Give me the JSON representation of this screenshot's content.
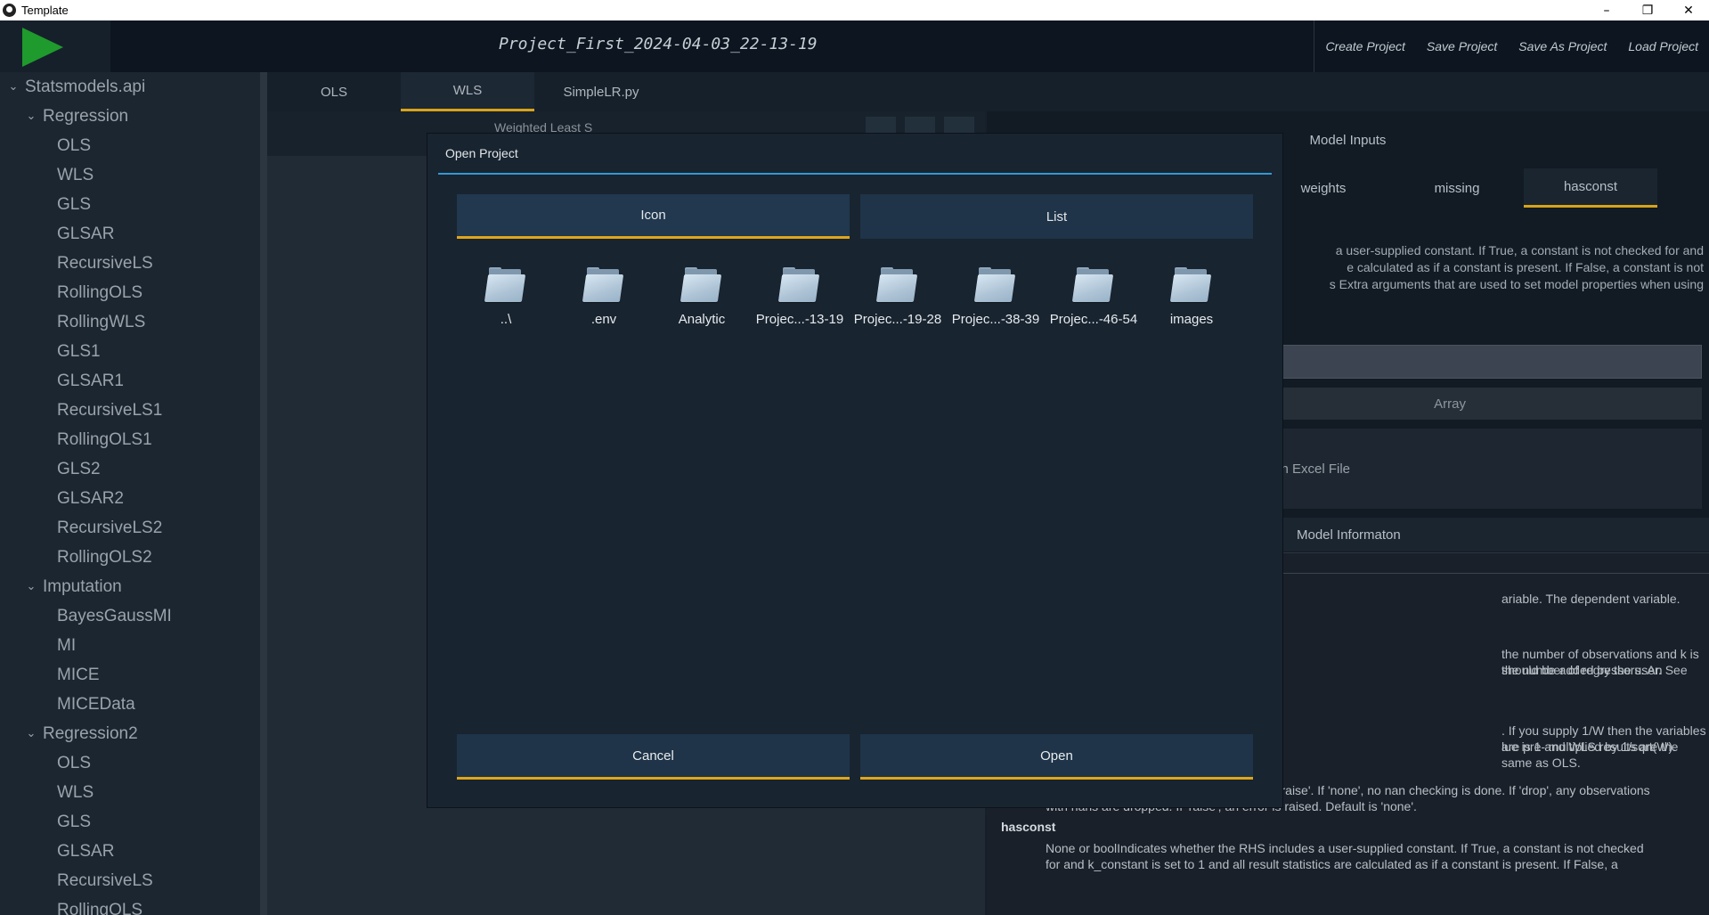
{
  "window": {
    "title": "Template",
    "minimize_glyph": "–",
    "maximize_glyph": "❐",
    "close_glyph": "✕"
  },
  "header": {
    "project_title": "Project_First_2024-04-03_22-13-19",
    "actions": [
      "Create Project",
      "Save Project",
      "Save As Project",
      "Load Project"
    ]
  },
  "sidebar": {
    "rows": [
      {
        "label": "Statsmodels.api",
        "level": 0,
        "expanded": true
      },
      {
        "label": "Regression",
        "level": 1,
        "expanded": true
      },
      {
        "label": "OLS",
        "level": 2
      },
      {
        "label": "WLS",
        "level": 2
      },
      {
        "label": "GLS",
        "level": 2
      },
      {
        "label": "GLSAR",
        "level": 2
      },
      {
        "label": "RecursiveLS",
        "level": 2
      },
      {
        "label": "RollingOLS",
        "level": 2
      },
      {
        "label": "RollingWLS",
        "level": 2
      },
      {
        "label": "GLS1",
        "level": 2
      },
      {
        "label": "GLSAR1",
        "level": 2
      },
      {
        "label": "RecursiveLS1",
        "level": 2
      },
      {
        "label": "RollingOLS1",
        "level": 2
      },
      {
        "label": "GLS2",
        "level": 2
      },
      {
        "label": "GLSAR2",
        "level": 2
      },
      {
        "label": "RecursiveLS2",
        "level": 2
      },
      {
        "label": "RollingOLS2",
        "level": 2
      },
      {
        "label": "Imputation",
        "level": 1,
        "expanded": true
      },
      {
        "label": "BayesGaussMI",
        "level": 2
      },
      {
        "label": "MI",
        "level": 2
      },
      {
        "label": "MICE",
        "level": 2
      },
      {
        "label": "MICEData",
        "level": 2
      },
      {
        "label": "Regression2",
        "level": 1,
        "expanded": true
      },
      {
        "label": "OLS",
        "level": 2
      },
      {
        "label": "WLS",
        "level": 2
      },
      {
        "label": "GLS",
        "level": 2
      },
      {
        "label": "GLSAR",
        "level": 2
      },
      {
        "label": "RecursiveLS",
        "level": 2
      },
      {
        "label": "RollingOLS",
        "level": 2
      }
    ]
  },
  "main": {
    "tabs": [
      {
        "label": "OLS",
        "active": false
      },
      {
        "label": "WLS",
        "active": true
      },
      {
        "label": "SimpleLR.py",
        "active": false
      }
    ],
    "partial_label": "Weighted Least S"
  },
  "model_inputs": {
    "header": "Model Inputs",
    "tabs": [
      {
        "label": "weights",
        "active": false
      },
      {
        "label": "missing",
        "active": false
      },
      {
        "label": "hasconst",
        "active": true
      }
    ],
    "description_lines": [
      "a user-supplied constant. If True, a constant is not checked for and",
      "e calculated as if a constant is present. If False, a constant is not",
      "s Extra arguments that are used to set model properties when using"
    ],
    "array_button": "Array",
    "excel_button": "Open Excel File"
  },
  "model_info": {
    "header": "Model Informaton",
    "lines": [
      "ariable. The dependent variable.",
      "the number of observations and k is the number of regressors. An",
      "should be added by the user. See",
      ". If you supply 1/W then the variables are pre- multiplied by 1/sqrt(W).",
      "lue is 1 and WLS results are the same as OLS.",
      "strAvailable options are 'none', 'drop', and 'raise'. If 'none', no nan checking is done. If 'drop', any observations",
      "with nans are dropped. If 'raise', an error is raised. Default is 'none'.",
      "hasconst",
      "None or boolIndicates whether the RHS includes a user-supplied constant. If True, a constant is not checked",
      "for and k_constant is set to 1 and all result statistics are calculated as if a constant is present. If False, a"
    ]
  },
  "dialog": {
    "title": "Open Project",
    "view_modes": [
      {
        "label": "Icon",
        "active": true
      },
      {
        "label": "List",
        "active": false
      }
    ],
    "files": [
      "..\\",
      ".env",
      "Analytic",
      "Projec...-13-19",
      "Projec...-19-28",
      "Projec...-38-39",
      "Projec...-46-54",
      "images"
    ],
    "cancel_label": "Cancel",
    "open_label": "Open"
  },
  "colors": {
    "accent_underline": "#e0a51a",
    "dialog_title_underline": "#3597d3",
    "play_green": "#1f9a2c"
  }
}
